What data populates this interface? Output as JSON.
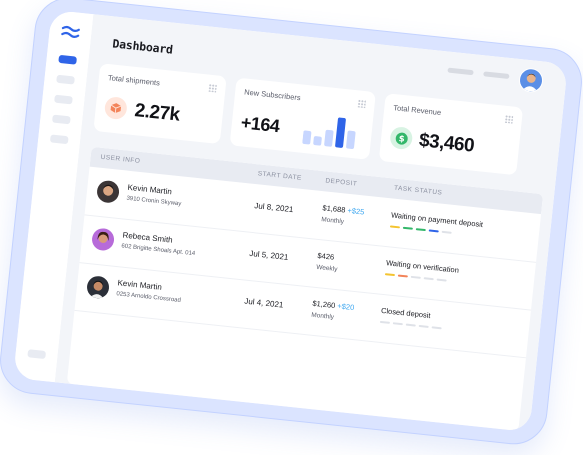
{
  "header": {
    "title": "Dashboard"
  },
  "cards": {
    "shipments": {
      "title": "Total shipments",
      "value": "2.27k",
      "icon": "package-icon",
      "icon_bg": "#ffe6dc",
      "icon_color": "#f3845a"
    },
    "subscribers": {
      "title": "New Subscribers",
      "value": "+164",
      "bars": [
        0.45,
        0.3,
        0.55,
        1.0,
        0.6
      ],
      "bar_colors": [
        "#c7d6ff",
        "#c7d6ff",
        "#c7d6ff",
        "#2f64e8",
        "#c7d6ff"
      ]
    },
    "revenue": {
      "title": "Total Revenue",
      "value": "$3,460",
      "icon": "dollar-icon",
      "icon_bg": "#d8f3e3",
      "icon_color": "#33b76a"
    }
  },
  "table": {
    "headers": {
      "user_info": "USER INFO",
      "start_date": "START DATE",
      "deposit": "DEPOSIT",
      "task_status": "TASK STATUS"
    },
    "rows": [
      {
        "name": "Kevin Martin",
        "address": "3910 Cronin Skyway",
        "start_date": "Jul 8, 2021",
        "deposit": "$1,688",
        "deposit_extra": "+$25",
        "frequency": "Monthly",
        "status": "Waiting on payment deposit",
        "progress_colors": [
          "#f4c430",
          "#33b76a",
          "#33b76a",
          "#2f64e8",
          "#dfe2e8"
        ]
      },
      {
        "name": "Rebeca Smith",
        "address": "602 Brigitte Shoals Apt. 014",
        "start_date": "Jul 5, 2021",
        "deposit": "$426",
        "deposit_extra": "",
        "frequency": "Weekly",
        "status": "Waiting on verification",
        "progress_colors": [
          "#f4c430",
          "#f3845a",
          "#dfe2e8",
          "#dfe2e8",
          "#dfe2e8"
        ]
      },
      {
        "name": "Kevin Martin",
        "address": "0253 Arnoldo Crossroad",
        "start_date": "Jul 4, 2021",
        "deposit": "$1,260",
        "deposit_extra": "+$20",
        "frequency": "Monthly",
        "status": "Closed deposit",
        "progress_colors": [
          "#dfe2e8",
          "#dfe2e8",
          "#dfe2e8",
          "#dfe2e8",
          "#dfe2e8"
        ]
      }
    ]
  },
  "colors": {
    "accent": "#2f64e8",
    "frame": "#dbe4ff"
  }
}
